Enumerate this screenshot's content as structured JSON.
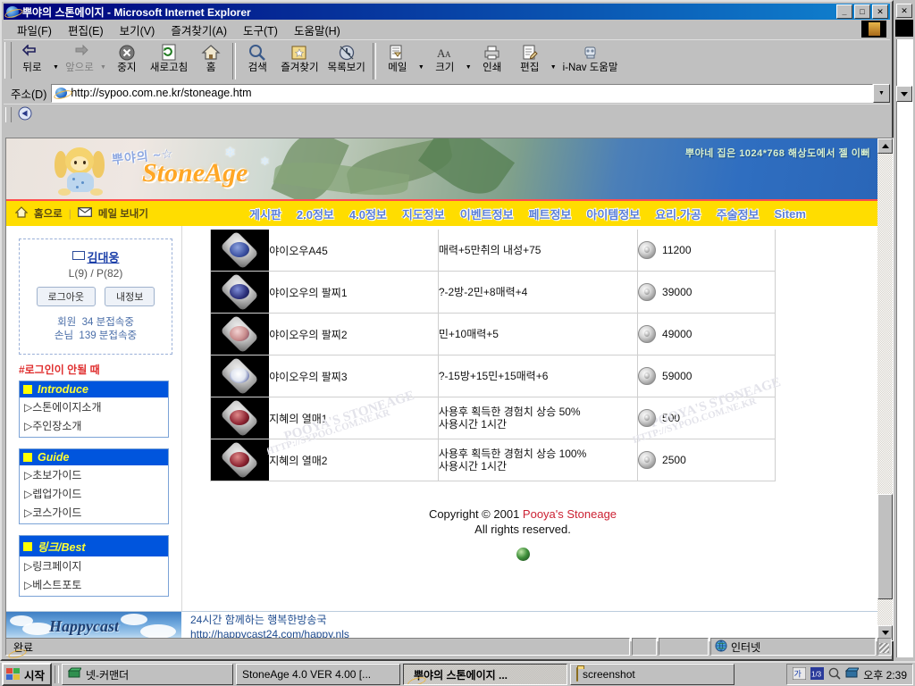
{
  "window": {
    "title": "뿌야의 스톤에이지 - Microsoft Internet Explorer",
    "minimize": "_",
    "maximize": "□",
    "close": "✕"
  },
  "menubar": [
    {
      "label": "파일(F)"
    },
    {
      "label": "편집(E)"
    },
    {
      "label": "보기(V)"
    },
    {
      "label": "즐겨찾기(A)"
    },
    {
      "label": "도구(T)"
    },
    {
      "label": "도움말(H)"
    }
  ],
  "toolbar": {
    "buttons": [
      {
        "label": "뒤로",
        "icon": "back-arrow-icon",
        "disabled": false,
        "dropdown": true
      },
      {
        "label": "앞으로",
        "icon": "forward-arrow-icon",
        "disabled": true,
        "dropdown": true
      },
      {
        "label": "중지",
        "icon": "stop-icon",
        "disabled": false
      },
      {
        "label": "새로고침",
        "icon": "refresh-icon",
        "disabled": false
      },
      {
        "label": "홈",
        "icon": "home-icon",
        "disabled": false
      },
      {
        "label": "검색",
        "icon": "search-icon",
        "disabled": false
      },
      {
        "label": "즐겨찾기",
        "icon": "favorites-star-icon",
        "disabled": false
      },
      {
        "label": "목록보기",
        "icon": "history-icon",
        "disabled": false
      },
      {
        "label": "메일",
        "icon": "mail-icon",
        "disabled": false,
        "dropdown": true
      },
      {
        "label": "크기",
        "icon": "font-size-icon",
        "disabled": false,
        "dropdown": true
      },
      {
        "label": "인쇄",
        "icon": "print-icon",
        "disabled": false
      },
      {
        "label": "편집",
        "icon": "edit-icon",
        "disabled": false,
        "dropdown": true
      },
      {
        "label": "i-Nav 도움말",
        "icon": "inav-help-icon",
        "disabled": false
      }
    ]
  },
  "address": {
    "label": "주소(D)",
    "url": "http://sypoo.com.ne.kr/stoneage.htm",
    "dropdown_glyph": "▼"
  },
  "site": {
    "logo_kr": "뿌야의 ~☆",
    "logo_en": "StoneAge",
    "banner_note": "뿌야네 집은 1024*768 해상도에서 젤 이뻐",
    "quicklinks": [
      {
        "label": "홈으로",
        "icon": "home-icon"
      },
      {
        "label": "메일 보내기",
        "icon": "mail-icon"
      }
    ],
    "nav": [
      {
        "label": "게시판"
      },
      {
        "label": "2.0정보"
      },
      {
        "label": "4.0정보"
      },
      {
        "label": "지도정보"
      },
      {
        "label": "이벤트정보"
      },
      {
        "label": "페트정보"
      },
      {
        "label": "아이템정보"
      },
      {
        "label": "요리.가공"
      },
      {
        "label": "주술정보"
      },
      {
        "label": "Sitem"
      }
    ]
  },
  "sidebar": {
    "login": {
      "username": "김대웅",
      "level_power": "L(9) / P(82)",
      "logout_button": "로그아웃",
      "myinfo_button": "내정보",
      "member_label": "회원",
      "member_value": "34 분접속중",
      "guest_label": "손님",
      "guest_value": "139 분접속중"
    },
    "not_login_note": "#로그인이 안될 때",
    "sections": [
      {
        "title": "Introduce",
        "items": [
          {
            "label": "▷스톤에이지소개"
          },
          {
            "label": "▷주인장소개"
          }
        ]
      },
      {
        "title": "Guide",
        "items": [
          {
            "label": "▷초보가이드"
          },
          {
            "label": "▷렙업가이드"
          },
          {
            "label": "▷코스가이드"
          }
        ]
      },
      {
        "title": "링크/Best",
        "items": [
          {
            "label": "▷링크페이지"
          },
          {
            "label": "▷베스트포토"
          }
        ]
      }
    ]
  },
  "items": [
    {
      "name": "야이오우A45",
      "desc": "매력+5만취의 내성+75",
      "price": "11200",
      "jewel": "#3a4fa0"
    },
    {
      "name": "야이오우의 팔찌1",
      "desc": "?-2방-2민+8매력+4",
      "price": "39000",
      "jewel": "#2b2f7a"
    },
    {
      "name": "야이오우의 팔찌2",
      "desc": "민+10매력+5",
      "price": "49000",
      "jewel": "#c98d8d"
    },
    {
      "name": "야이오우의 팔찌3",
      "desc": "?-15방+15민+15매력+6",
      "price": "59000",
      "jewel": "#dfe4ef"
    },
    {
      "name": "지혜의 열매1",
      "desc": "사용후 획득한 경험치 상승 50%\n사용시간 1시간",
      "price": "500",
      "jewel": "#8b2230"
    },
    {
      "name": "지혜의 열매2",
      "desc": "사용후 획득한 경험치 상승 100%\n사용시간 1시간",
      "price": "2500",
      "jewel": "#8b2230"
    }
  ],
  "footer": {
    "copyright_prefix": "Copyright © 2001 ",
    "copyright_site": "Pooya's Stoneage",
    "rights": "All rights reserved."
  },
  "watermarks": [
    "POOYA'S STONEAGE",
    "HTTP://SYPOO.COM.NE.KR"
  ],
  "ad": {
    "brand": "Happycast",
    "line1": "24시간 함께하는 행복한방송국",
    "line2": "http://happycast24.com/happy.nls"
  },
  "statusbar": {
    "message": "완료",
    "zone": "인터넷",
    "zone_icon": "globe-icon"
  },
  "taskbar": {
    "start": "시작",
    "items": [
      {
        "label": "넷-커맨더",
        "icon": "net-commander-icon",
        "active": false
      },
      {
        "label": "StoneAge 4.0 VER 4.00 [...",
        "icon": "",
        "active": false
      },
      {
        "label": "뿌야의 스톤에이지 ...",
        "icon": "ie-icon",
        "active": true
      },
      {
        "label": "screenshot",
        "icon": "folder-icon",
        "active": false
      }
    ],
    "tray_icons": [
      "keyboard-ime-icon",
      "input-method-icon",
      "magnifier-icon",
      "network-icon"
    ],
    "clock": "오후 2:39"
  }
}
